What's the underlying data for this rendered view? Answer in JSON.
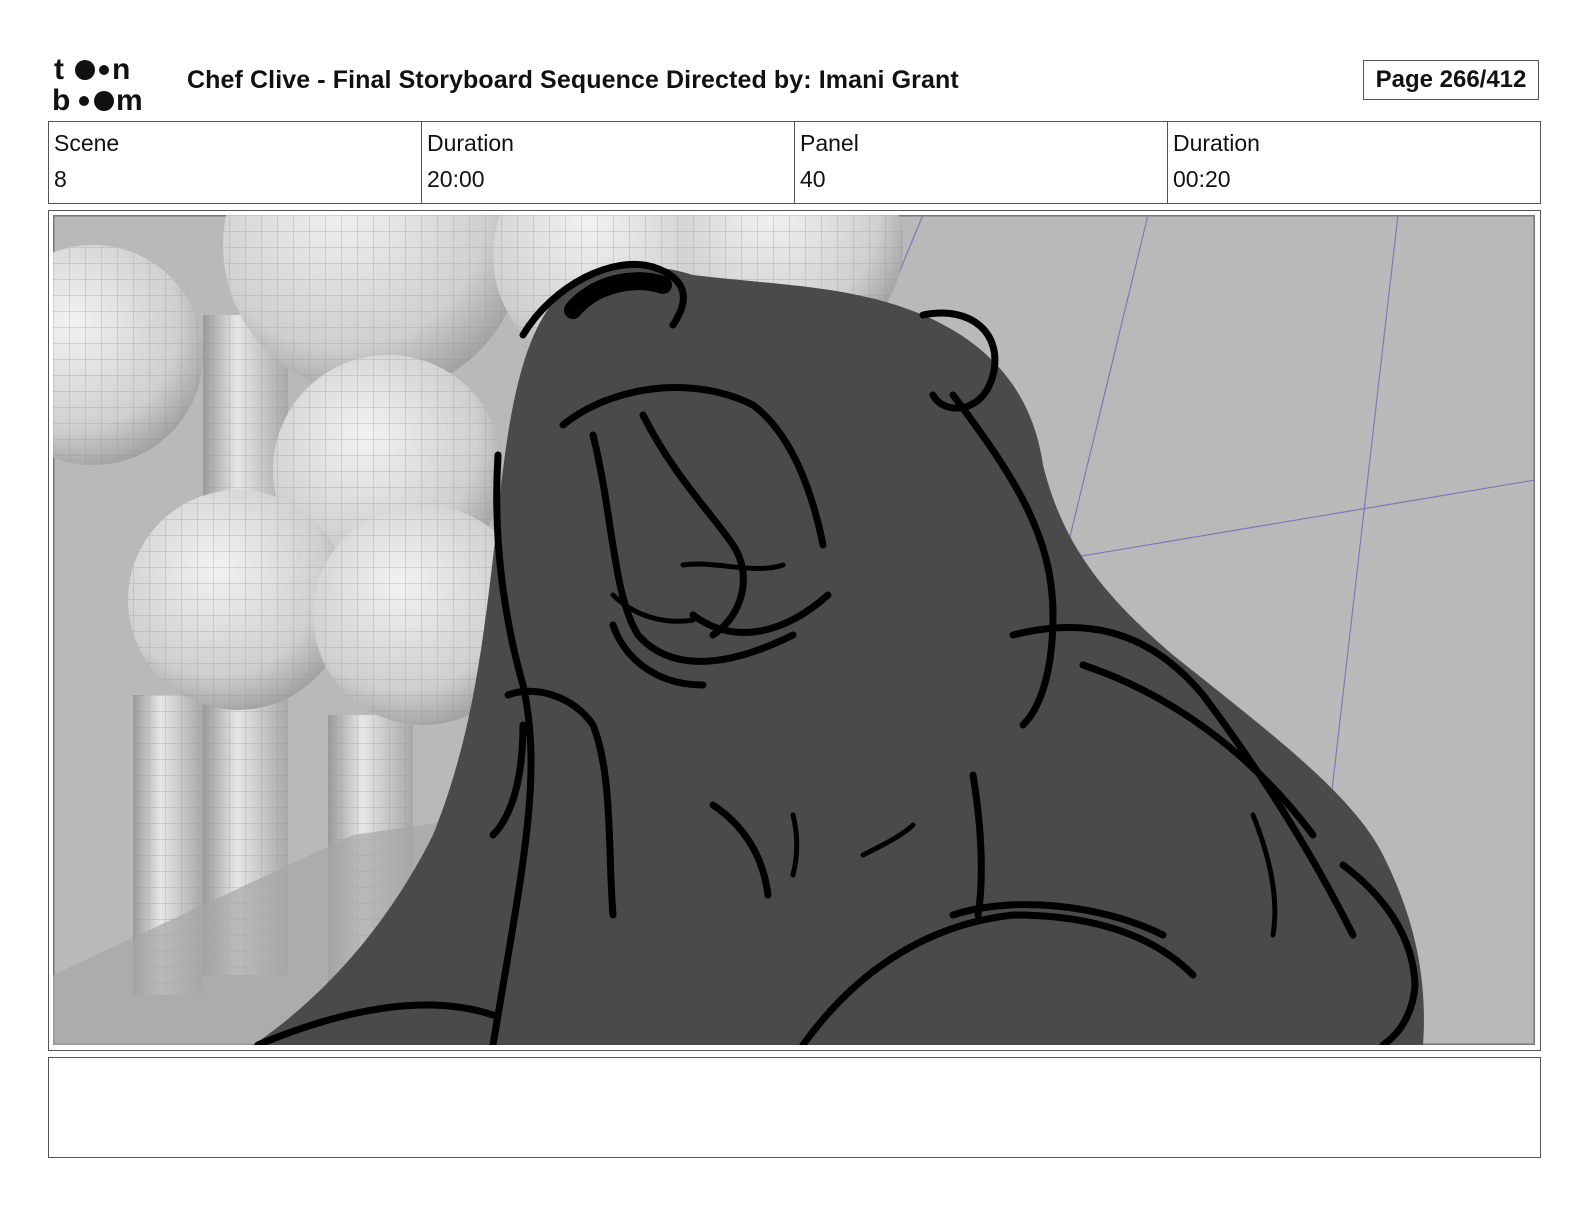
{
  "header": {
    "logo_text": "toon boom",
    "title": "Chef Clive - Final Storyboard Sequence  Directed by: Imani Grant",
    "page": "Page 266/412"
  },
  "info": [
    {
      "label": "Scene",
      "value": "8"
    },
    {
      "label": "Duration",
      "value": "20:00"
    },
    {
      "label": "Panel",
      "value": "40"
    },
    {
      "label": "Duration",
      "value": "00:20"
    }
  ],
  "panel": {
    "image_subject": "bear-roaring-sketch",
    "background_color": "#b9b9b9",
    "grid_line_color": "#7a7ab8",
    "figure_fill": "#4a4a4a"
  },
  "notes": {
    "text": ""
  }
}
